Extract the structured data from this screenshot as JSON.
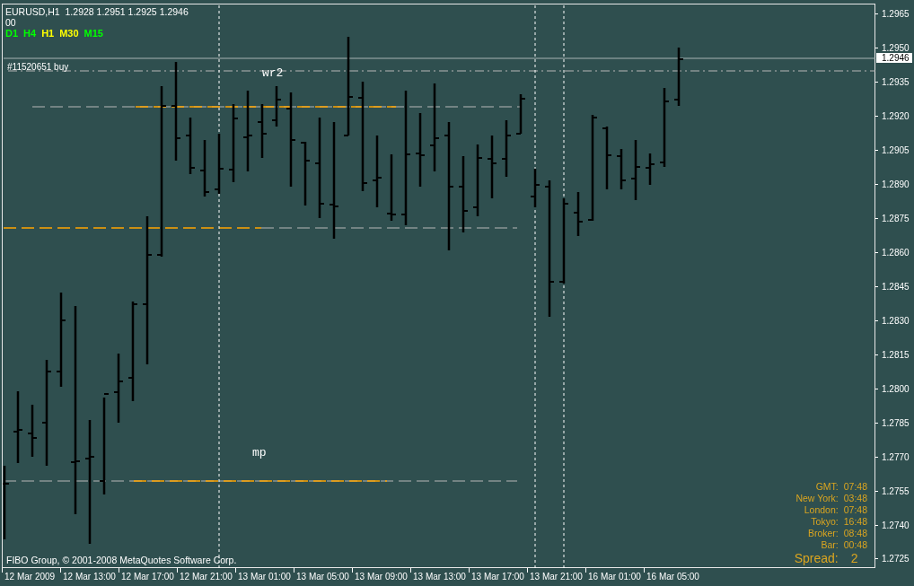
{
  "chart": {
    "symbol": "EURUSD,H1",
    "quote": "1.2928 1.2951 1.2925 1.2946",
    "counter": "00",
    "timeframes": [
      {
        "label": "D1",
        "color": "#00ff00"
      },
      {
        "label": "H4",
        "color": "#00ff00"
      },
      {
        "label": "H1",
        "color": "#ffff00"
      },
      {
        "label": "M30",
        "color": "#ffff00"
      },
      {
        "label": "M15",
        "color": "#00ff00"
      }
    ],
    "order_label": "#11520651 buy",
    "level_labels": [
      "wr2",
      "mp"
    ],
    "copyright": "FIBO Group, © 2001-2008 MetaQuotes Software Corp.",
    "clock": [
      {
        "label": "GMT:",
        "time": "07:48"
      },
      {
        "label": "New York:",
        "time": "03:48"
      },
      {
        "label": "London:",
        "time": "07:48"
      },
      {
        "label": "Tokyo:",
        "time": "16:48"
      },
      {
        "label": "Broker:",
        "time": "08:48"
      },
      {
        "label": "Bar:",
        "time": "00:48"
      }
    ],
    "spread": {
      "label": "Spread:",
      "value": "2"
    }
  },
  "price_axis": {
    "labels": [
      "1.2965",
      "1.2950",
      "1.2935",
      "1.2920",
      "1.2905",
      "1.2890",
      "1.2875",
      "1.2860",
      "1.2845",
      "1.2830",
      "1.2815",
      "1.2800",
      "1.2785",
      "1.2770",
      "1.2755",
      "1.2740",
      "1.2725"
    ],
    "current_price": "1.2946"
  },
  "time_axis": {
    "labels": [
      "12 Mar 2009",
      "12 Mar 13:00",
      "12 Mar 17:00",
      "12 Mar 21:00",
      "13 Mar 01:00",
      "13 Mar 05:00",
      "13 Mar 09:00",
      "13 Mar 13:00",
      "13 Mar 17:00",
      "13 Mar 21:00",
      "16 Mar 01:00",
      "16 Mar 05:00"
    ]
  }
}
